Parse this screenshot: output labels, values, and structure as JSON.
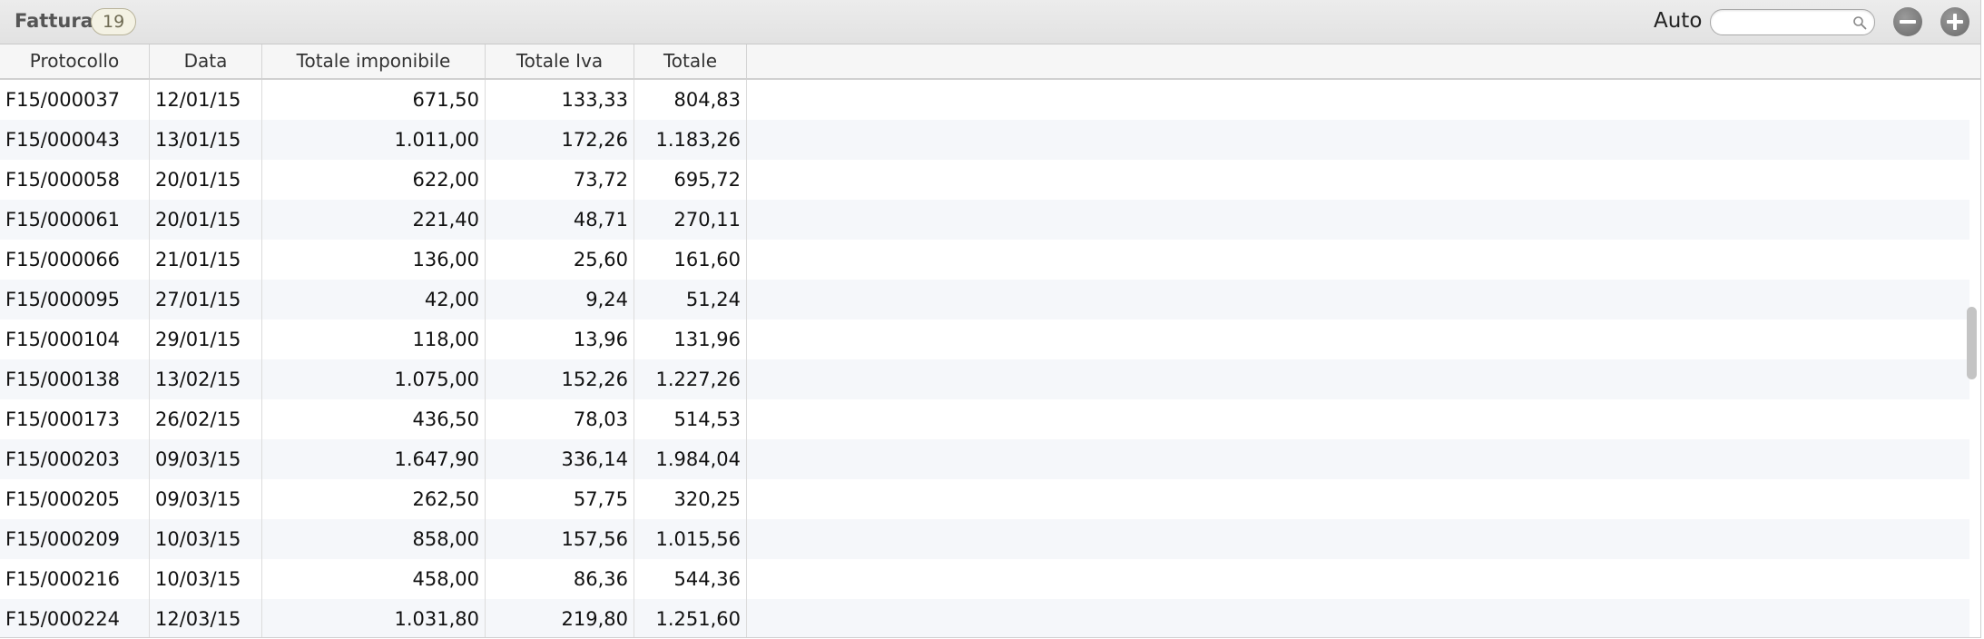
{
  "header": {
    "title": "Fattura",
    "count": "19",
    "mode_label": "Auto",
    "search": {
      "value": "",
      "placeholder": ""
    }
  },
  "table": {
    "columns": [
      "Protocollo",
      "Data",
      "Totale imponibile",
      "Totale Iva",
      "Totale"
    ],
    "rows": [
      [
        "F15/000037",
        "12/01/15",
        "671,50",
        "133,33",
        "804,83"
      ],
      [
        "F15/000043",
        "13/01/15",
        "1.011,00",
        "172,26",
        "1.183,26"
      ],
      [
        "F15/000058",
        "20/01/15",
        "622,00",
        "73,72",
        "695,72"
      ],
      [
        "F15/000061",
        "20/01/15",
        "221,40",
        "48,71",
        "270,11"
      ],
      [
        "F15/000066",
        "21/01/15",
        "136,00",
        "25,60",
        "161,60"
      ],
      [
        "F15/000095",
        "27/01/15",
        "42,00",
        "9,24",
        "51,24"
      ],
      [
        "F15/000104",
        "29/01/15",
        "118,00",
        "13,96",
        "131,96"
      ],
      [
        "F15/000138",
        "13/02/15",
        "1.075,00",
        "152,26",
        "1.227,26"
      ],
      [
        "F15/000173",
        "26/02/15",
        "436,50",
        "78,03",
        "514,53"
      ],
      [
        "F15/000203",
        "09/03/15",
        "1.647,90",
        "336,14",
        "1.984,04"
      ],
      [
        "F15/000205",
        "09/03/15",
        "262,50",
        "57,75",
        "320,25"
      ],
      [
        "F15/000209",
        "10/03/15",
        "858,00",
        "157,56",
        "1.015,56"
      ],
      [
        "F15/000216",
        "10/03/15",
        "458,00",
        "86,36",
        "544,36"
      ],
      [
        "F15/000224",
        "12/03/15",
        "1.031,80",
        "219,80",
        "1.251,60"
      ]
    ]
  },
  "icons": {
    "search": "magnifier-icon",
    "remove": "minus-circle-icon",
    "add": "plus-circle-icon"
  },
  "colors": {
    "badge_border": "#b8b39a",
    "row_alt": "#f5f7fa",
    "button": "#7a7a7a"
  }
}
